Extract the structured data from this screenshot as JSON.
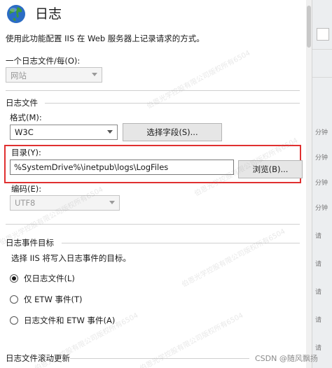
{
  "header": {
    "title": "日志"
  },
  "description": "使用此功能配置 IIS 在 Web 服务器上记录请求的方式。",
  "per_site": {
    "label": "一个日志文件/每(O):",
    "value": "网站"
  },
  "log_file": {
    "section_label": "日志文件",
    "format_label": "格式(M):",
    "format_value": "W3C",
    "select_fields_button": "选择字段(S)...",
    "directory_label": "目录(Y):",
    "directory_value": "%SystemDrive%\\inetpub\\logs\\LogFiles",
    "browse_button": "浏览(B)...",
    "encoding_label": "编码(E):",
    "encoding_value": "UTF8"
  },
  "log_event_target": {
    "section_label": "日志事件目标",
    "prompt": "选择 IIS 将写入日志事件的目标。",
    "options": [
      {
        "label": "仅日志文件(L)",
        "checked": true
      },
      {
        "label": "仅 ETW 事件(T)",
        "checked": false
      },
      {
        "label": "日志文件和 ETW 事件(A)",
        "checked": false
      }
    ]
  },
  "rollover": {
    "section_label": "日志文件滚动更新"
  },
  "watermark": "伯恩光学控股有限公司版权所有6504",
  "credit": "CSDN @随风飘扬",
  "right_strip": [
    "分钟",
    "分钟",
    "分钟",
    "分钟",
    "请",
    "请",
    "请",
    "请",
    "请"
  ],
  "colors": {
    "highlight": "#e03030",
    "globe_blue": "#2b6cc4",
    "globe_green": "#3a9a3a"
  },
  "icons": {
    "site_icon": "globe-icon"
  }
}
